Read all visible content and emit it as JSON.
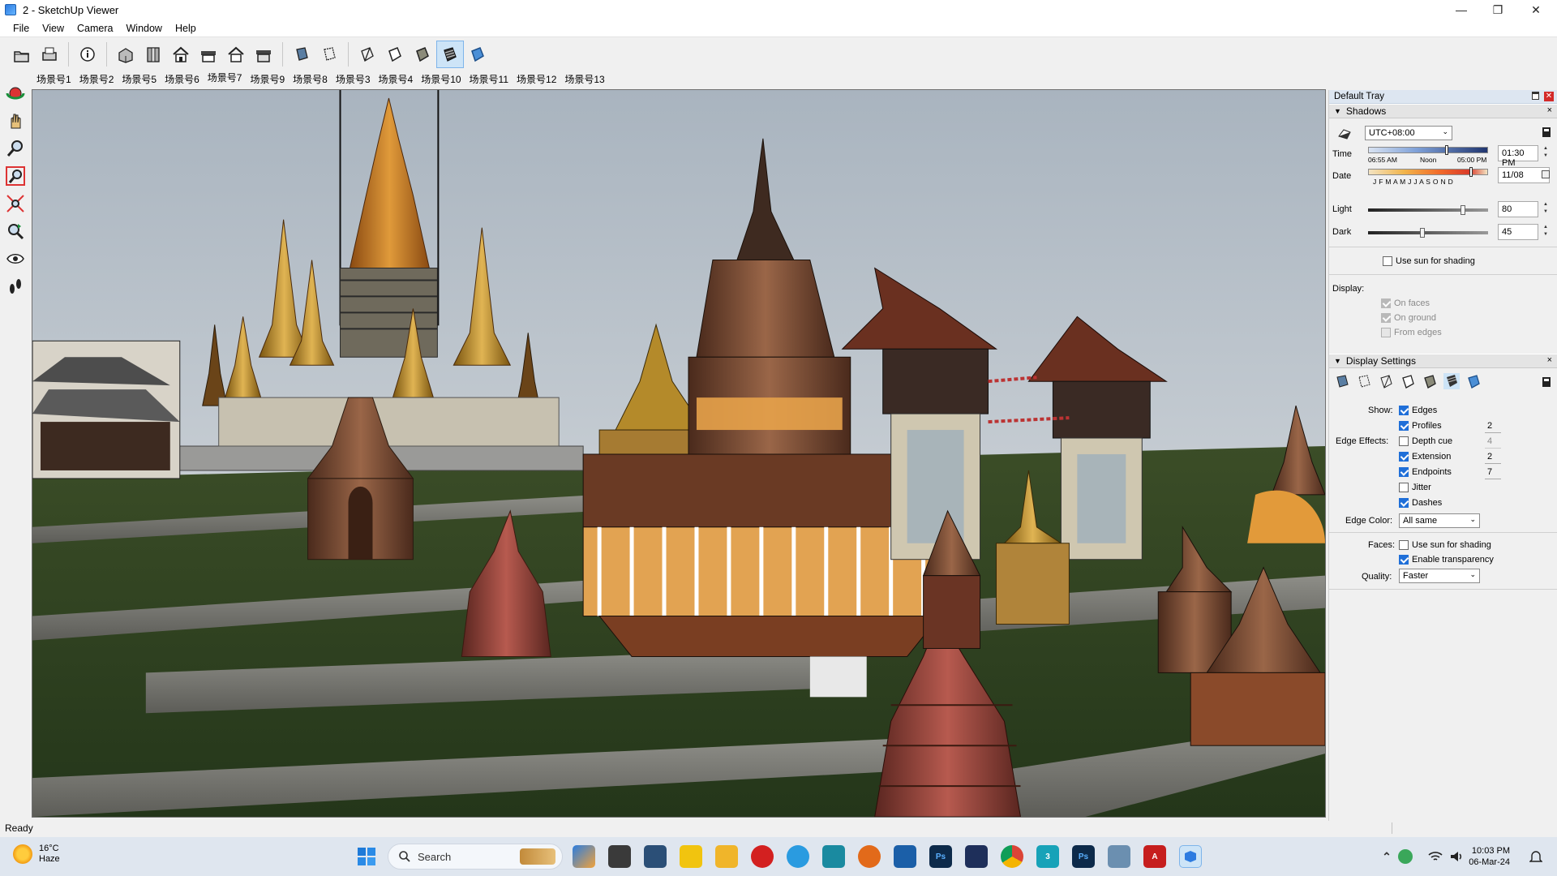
{
  "window": {
    "title": "2 - SketchUp Viewer"
  },
  "menu": [
    "File",
    "View",
    "Camera",
    "Window",
    "Help"
  ],
  "scenes": [
    "场景号1",
    "场景号2",
    "场景号5",
    "场景号6",
    "场景号7",
    "场景号9",
    "场景号8",
    "场景号3",
    "场景号4",
    "场景号10",
    "场景号11",
    "场景号12",
    "场景号13"
  ],
  "toolbar": {
    "icons": [
      "open-icon",
      "print-icon",
      "model-info-icon",
      "iso-view-icon",
      "top-view-icon",
      "front-view-icon",
      "right-view-icon",
      "back-view-icon",
      "left-view-icon",
      "xray-icon",
      "back-edges-icon",
      "wireframe-icon",
      "hidden-line-icon",
      "shaded-icon",
      "shaded-textures-icon",
      "monochrome-icon"
    ],
    "active": "shaded-textures-icon"
  },
  "left_tools": [
    "orbit-icon",
    "pan-icon",
    "zoom-icon",
    "zoom-window-icon",
    "zoom-extents-icon",
    "previous-view-icon",
    "look-around-icon",
    "walk-icon"
  ],
  "tray": {
    "title": "Default Tray",
    "shadows": {
      "title": "Shadows",
      "timezone": "UTC+08:00",
      "time_label": "Time",
      "time_start": "06:55 AM",
      "time_noon": "Noon",
      "time_end": "05:00 PM",
      "time_value": "01:30 PM",
      "time_fraction": 0.65,
      "date_label": "Date",
      "months": "J F M A M J J A S O N D",
      "date_value": "11/08",
      "date_fraction": 0.86,
      "light_label": "Light",
      "light_value": "80",
      "dark_label": "Dark",
      "dark_value": "45",
      "use_sun": "Use sun for shading",
      "display_label": "Display:",
      "on_faces": "On faces",
      "on_ground": "On ground",
      "from_edges": "From edges"
    },
    "display_settings": {
      "title": "Display Settings",
      "show_label": "Show:",
      "edges": "Edges",
      "profiles": "Profiles",
      "profiles_value": "2",
      "edge_effects_label": "Edge Effects:",
      "depth_cue": "Depth cue",
      "depth_cue_value": "4",
      "extension": "Extension",
      "extension_value": "2",
      "endpoints": "Endpoints",
      "endpoints_value": "7",
      "jitter": "Jitter",
      "dashes": "Dashes",
      "edge_color_label": "Edge Color:",
      "edge_color_value": "All same",
      "faces_label": "Faces:",
      "faces_use_sun": "Use sun for shading",
      "enable_transparency": "Enable transparency",
      "quality_label": "Quality:",
      "quality_value": "Faster"
    }
  },
  "status": {
    "text": "Ready"
  },
  "taskbar": {
    "temp": "16°C",
    "weather": "Haze",
    "search": "Search",
    "time": "10:03 PM",
    "date": "06-Mar-24"
  }
}
